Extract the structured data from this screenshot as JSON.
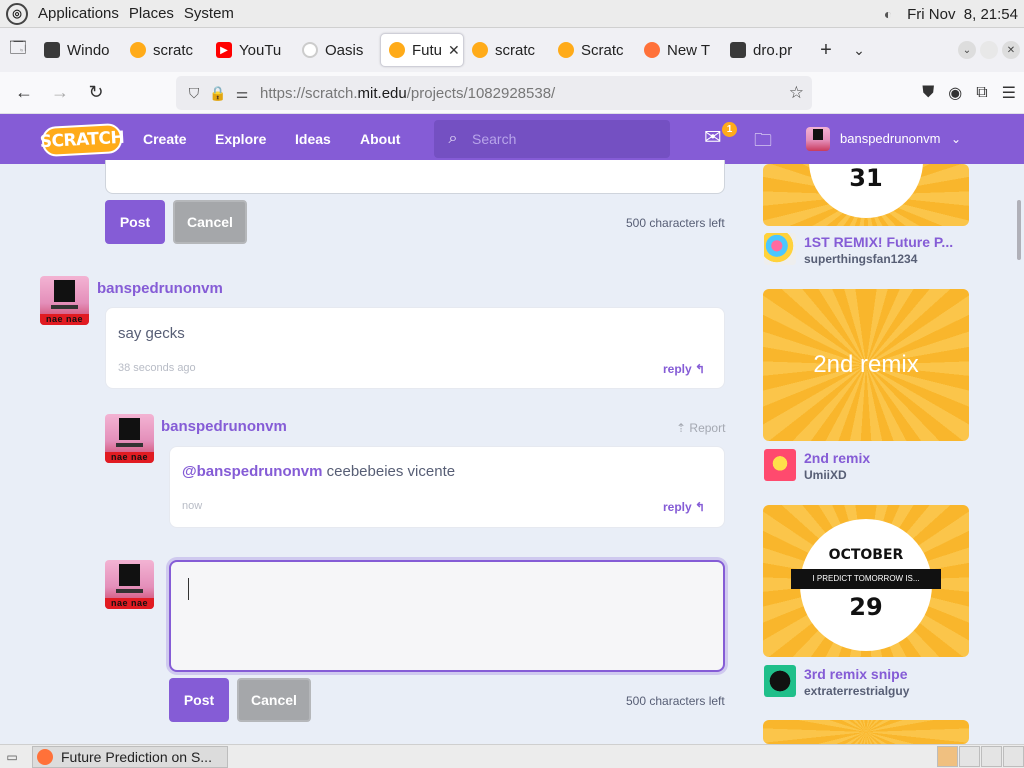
{
  "system_panel": {
    "menus": [
      "Applications",
      "Places",
      "System"
    ],
    "clock": "Fri Nov  8, 21:54"
  },
  "browser": {
    "tabs": [
      {
        "label": "Windo",
        "icon": "window-favicon",
        "color": "#3a3a3a"
      },
      {
        "label": "scratc",
        "icon": "scratch-favicon",
        "color": "#ffab19"
      },
      {
        "label": "YouTu",
        "icon": "youtube-favicon",
        "color": "#ff0000"
      },
      {
        "label": "Oasis",
        "icon": "oasis-favicon",
        "color": "#dddddd"
      },
      {
        "label": "Futu",
        "icon": "scratch-favicon",
        "color": "#ffab19",
        "active": true
      },
      {
        "label": "scratc",
        "icon": "scratch-favicon",
        "color": "#ffab19"
      },
      {
        "label": "Scratc",
        "icon": "scratch-favicon",
        "color": "#ffab19"
      },
      {
        "label": "New T",
        "icon": "firefox-favicon",
        "color": "#ff7139"
      },
      {
        "label": "dro.pr",
        "icon": "window-favicon",
        "color": "#3a3a3a"
      }
    ],
    "url_host_prefix": "https://scratch.",
    "url_host_main": "mit.edu",
    "url_path": "/projects/1082928538/"
  },
  "scratch_nav": {
    "logo": "SCRATCH",
    "links": [
      "Create",
      "Explore",
      "Ideas",
      "About"
    ],
    "search_placeholder": "Search",
    "message_count": "1",
    "username": "banspedrunonvm"
  },
  "comments": {
    "top_form": {
      "post": "Post",
      "cancel": "Cancel",
      "chars_left": "500 characters left"
    },
    "thread": {
      "user": "banspedrunonvm",
      "avatar_text": "nae nae",
      "text": "say gecks",
      "time": "38 seconds ago",
      "reply": "reply"
    },
    "reply": {
      "user": "banspedrunonvm",
      "report": "Report",
      "mention": "@banspedrunonvm",
      "text": " ceebebeies vicente",
      "time": "now",
      "reply": "reply"
    },
    "reply_form": {
      "value": "",
      "post": "Post",
      "cancel": "Cancel",
      "chars_left": "500 characters left"
    }
  },
  "remixes": [
    {
      "title": "1ST REMIX! Future P...",
      "user": "superthingsfan1234",
      "thumb_text": "31"
    },
    {
      "title": "2nd remix",
      "user": "UmiiXD",
      "thumb_text": "2nd remix"
    },
    {
      "title": "3rd remix snipe",
      "user": "extraterrestrialguy",
      "thumb_text_top": "OCTOBER",
      "thumb_banner": "I PREDICT TOMORROW IS...",
      "thumb_text": "29"
    }
  ],
  "taskbar": {
    "window_title": "Future Prediction on S..."
  }
}
